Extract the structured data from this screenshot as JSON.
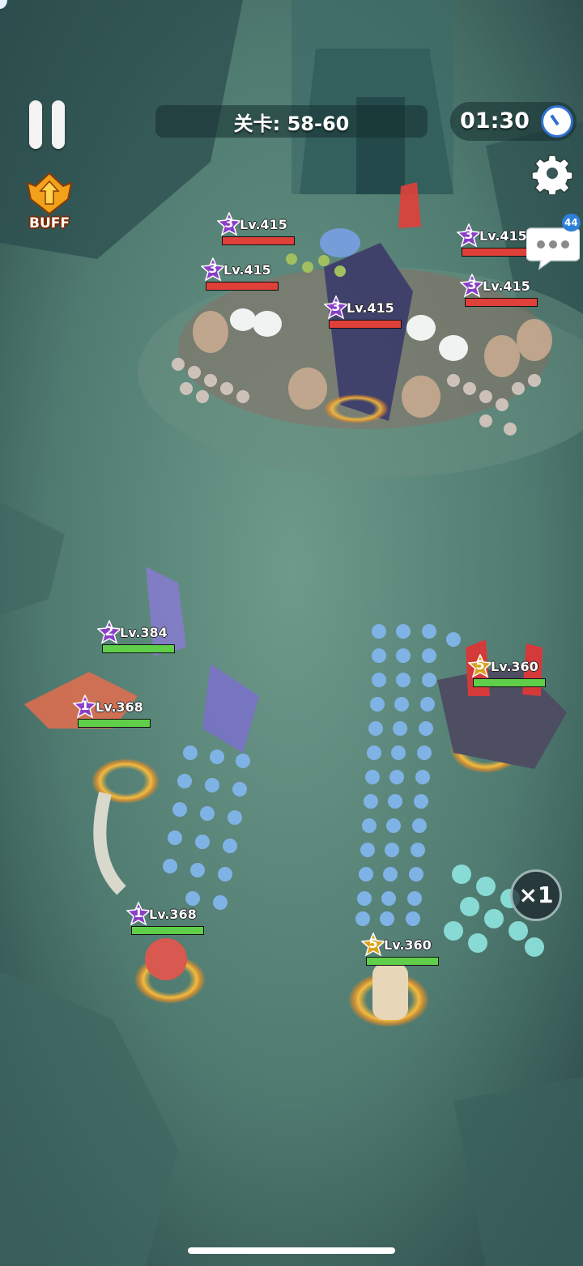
{
  "hud": {
    "stage_label": "关卡: 58-60",
    "timer": "01:30",
    "buff_label": "BUFF",
    "chat_badge": "44",
    "speed_multiplier": "×1"
  },
  "icons": [
    "pause-icon",
    "clock-icon",
    "gear-icon",
    "buff-icon",
    "chat-bubble-icon"
  ],
  "colors": {
    "enemy_hp": "#e0403a",
    "ally_hp": "#5fcf4a",
    "star_enemy": "#8a3fc6",
    "star_ally_gold": "#d9a21d"
  },
  "enemy_units": [
    {
      "stars": "3",
      "level": "Lv.415",
      "star_color": "purple",
      "hp": 1.0
    },
    {
      "stars": "3",
      "level": "Lv.415",
      "star_color": "purple",
      "hp": 1.0
    },
    {
      "stars": "3",
      "level": "Lv.415",
      "star_color": "purple",
      "hp": 1.0
    },
    {
      "stars": "3",
      "level": "Lv.415",
      "star_color": "purple",
      "hp": 1.0
    },
    {
      "stars": "3",
      "level": "Lv.415",
      "star_color": "purple",
      "hp": 1.0
    }
  ],
  "ally_units": [
    {
      "stars": "2",
      "level": "Lv.384",
      "star_color": "purple",
      "hp": 1.0
    },
    {
      "stars": "1",
      "level": "Lv.368",
      "star_color": "purple",
      "hp": 1.0
    },
    {
      "stars": "1",
      "level": "Lv.368",
      "star_color": "purple",
      "hp": 1.0
    },
    {
      "stars": "5",
      "level": "Lv.360",
      "star_color": "gold",
      "hp": 1.0
    },
    {
      "stars": "5",
      "level": "Lv.360",
      "star_color": "gold",
      "hp": 1.0
    }
  ]
}
